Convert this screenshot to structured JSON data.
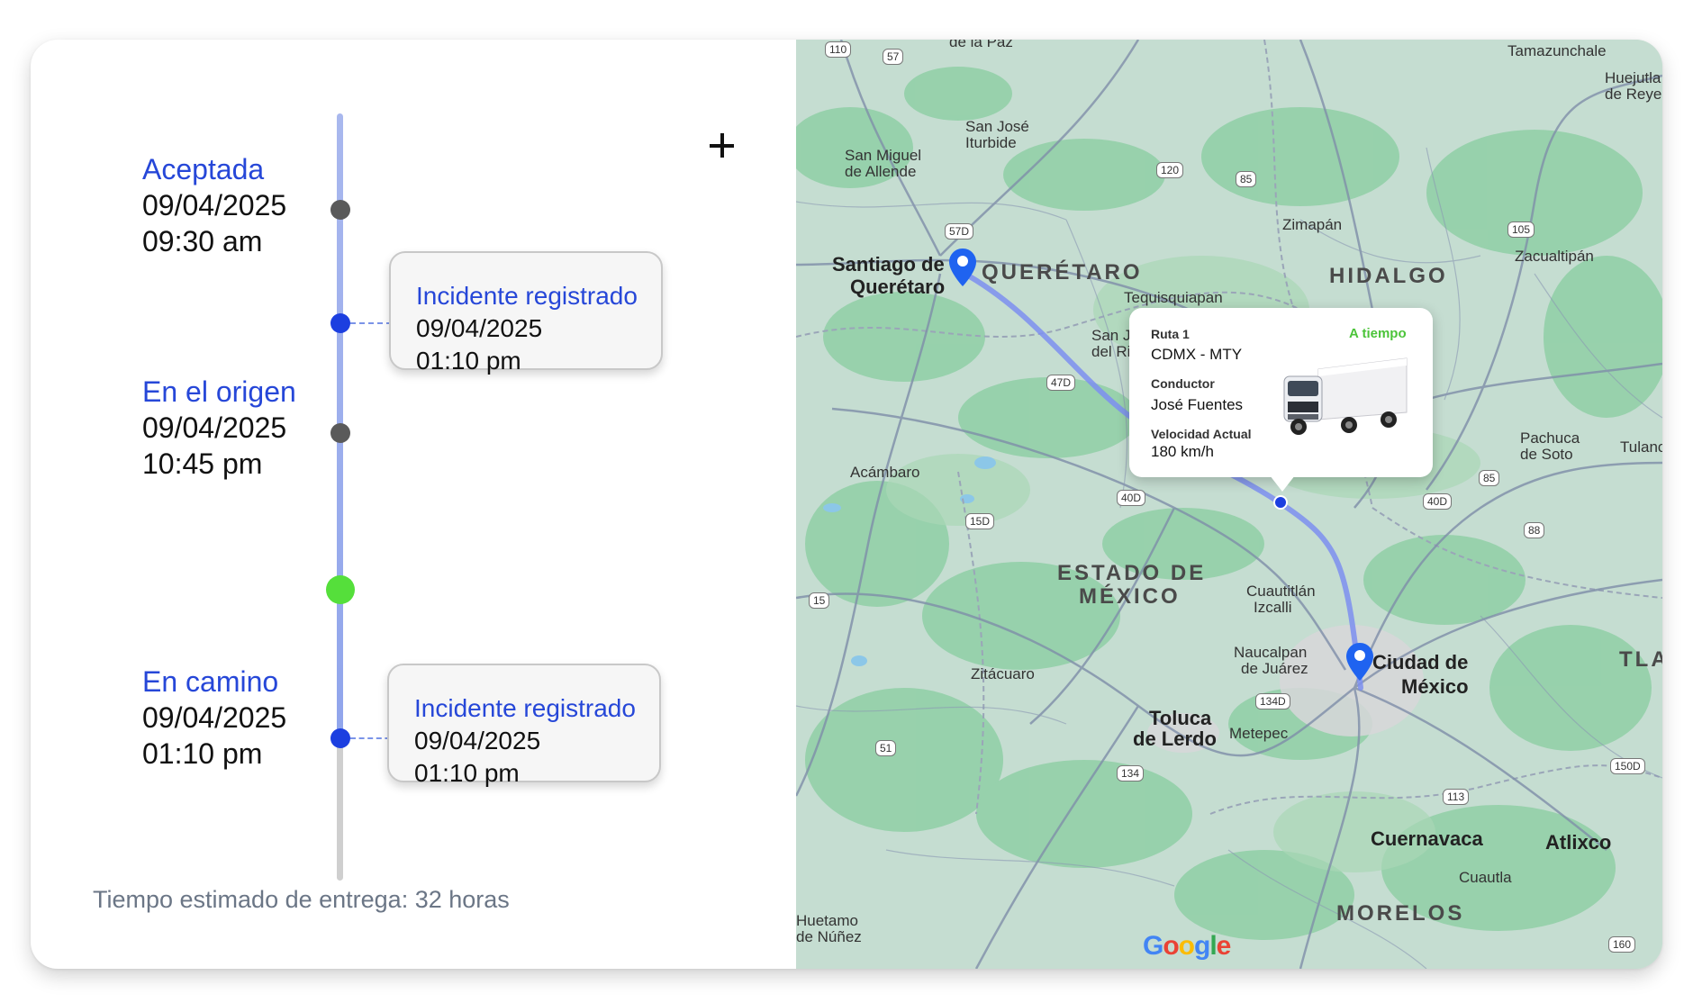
{
  "timeline": {
    "stages": [
      {
        "title": "Aceptada",
        "date": "09/04/2025",
        "time": "09:30 am"
      },
      {
        "title": "En el origen",
        "date": "09/04/2025",
        "time": "10:45 pm"
      },
      {
        "title": "En camino",
        "date": "09/04/2025",
        "time": "01:10 pm"
      }
    ],
    "incidents": [
      {
        "title": "Incidente registrado",
        "date": "09/04/2025",
        "time": "01:10 pm"
      },
      {
        "title": "Incidente registrado",
        "date": "09/04/2025",
        "time": "01:10 pm"
      }
    ],
    "eta": "Tiempo estimado de entrega: 32 horas"
  },
  "colors": {
    "accent": "#2647d8",
    "current_marker": "#55df3b",
    "completed_marker": "#5a5a5a",
    "incident_marker": "#1c3fe0",
    "status_on_time": "#4cc43a"
  },
  "icons": {
    "add": "plus-icon",
    "route_pin": "map-pin-icon",
    "vehicle": "truck-icon"
  },
  "popup": {
    "route_label": "Ruta 1",
    "route_value": "CDMX - MTY",
    "status": "A tiempo",
    "driver_label": "Conductor",
    "driver_value": "José Fuentes",
    "speed_label": "Velocidad Actual",
    "speed_value": "180 km/h"
  },
  "map": {
    "cities": {
      "queretaro_a": "Santiago de",
      "queretaro_b": "Querétaro",
      "cdmx_a": "Ciudad de",
      "cdmx_b": "México",
      "toluca_a": "Toluca",
      "toluca_b": "de Lerdo",
      "cuernavaca": "Cuernavaca",
      "atlixco": "Atlixco"
    },
    "states": {
      "queretaro": "QUERÉTARO",
      "hidalgo": "HIDALGO",
      "edomex_a": "ESTADO DE",
      "edomex_b": "MÉXICO",
      "morelos": "MORELOS",
      "tlaxcala": "TLAXC"
    },
    "places": {
      "de_la_paz": "de la Paz",
      "tamazunchale": "Tamazunchale",
      "huejutla_a": "Huejutla",
      "huejutla_b": "de Reyes",
      "san_jose_a": "San José",
      "san_jose_b": "Iturbide",
      "san_miguel_a": "San Miguel",
      "san_miguel_b": "de Allende",
      "zimapan": "Zimapán",
      "zacualtipan": "Zacualtipán",
      "tequisquiapan": "Tequisquiapan",
      "san_juan_a": "San J",
      "san_juan_b": "del Ri",
      "pachuca_a": "Pachuca",
      "pachuca_b": "de Soto",
      "tulanci": "Tulanci",
      "acambaro": "Acámbaro",
      "cuautitlan_a": "Cuautitlán",
      "cuautitlan_b": "Izcalli",
      "naucalpan_a": "Naucalpan",
      "naucalpan_b": "de Juárez",
      "zitacuaro": "Zitácuaro",
      "metepec": "Metepec",
      "cuautla": "Cuautla",
      "huetamo_a": "Huetamo",
      "huetamo_b": "de Núñez"
    },
    "shields": [
      "110",
      "57",
      "120",
      "85",
      "57D",
      "105",
      "47D",
      "40D",
      "15D",
      "85",
      "40D",
      "88",
      "15",
      "134D",
      "51",
      "134",
      "113",
      "150D",
      "160"
    ],
    "attribution": "Google"
  }
}
